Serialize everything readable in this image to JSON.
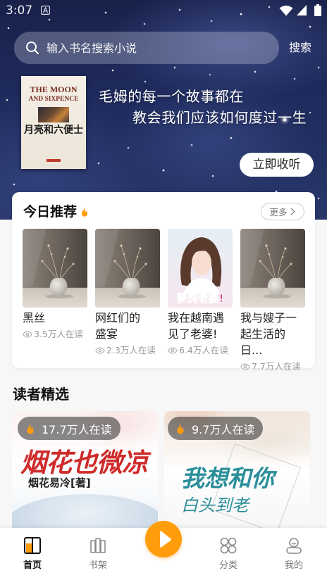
{
  "status_bar": {
    "time": "3:07"
  },
  "search": {
    "placeholder": "输入书名搜索小说",
    "button_label": "搜索"
  },
  "banner": {
    "cover": {
      "title_en_line1": "THE MOON",
      "title_en_line2": "AND SIXPENCE",
      "title_cn": "月亮和六便士"
    },
    "tagline_line1": "毛姆的每一个故事都在",
    "tagline_line2": "教会我们应该如何度过一生",
    "button_label": "立即收听"
  },
  "today": {
    "title": "今日推荐",
    "title_icon": "fire-icon",
    "more_label": "更多",
    "books": [
      {
        "title": "黑丝",
        "readers": "3.5万人在读",
        "cover": "vase-still-life"
      },
      {
        "title": "网红们的\n盛宴",
        "readers": "2.3万人在读",
        "cover": "vase-still-life"
      },
      {
        "title": "我在越南遇\n见了老婆!",
        "readers": "6.4万人在读",
        "cover": "girl-illustration",
        "cover_text": "萝莉老婆!"
      },
      {
        "title": "我与嫂子一\n起生活的日...",
        "readers": "7.7万人在读",
        "cover": "vase-still-life"
      }
    ]
  },
  "readers_pick": {
    "title": "读者精选",
    "books": [
      {
        "readers": "17.7万人在读",
        "cover_title": "烟花也微凉",
        "cover_author": "烟花易冷[著]"
      },
      {
        "readers": "9.7万人在读",
        "cover_title_line1": "我想和你",
        "cover_title_line2": "白头到老"
      }
    ]
  },
  "tabbar": {
    "items": [
      {
        "label": "首页",
        "icon": "home-book-icon",
        "active": true
      },
      {
        "label": "书架",
        "icon": "bookshelf-icon",
        "active": false
      },
      {
        "label": "分类",
        "icon": "category-icon",
        "active": false
      },
      {
        "label": "我的",
        "icon": "profile-icon",
        "active": false
      }
    ],
    "center_button_icon": "play-icon"
  },
  "colors": {
    "accent": "#FF9D0D",
    "banner_bg": "#1F2B5D",
    "active_tab": "#111111",
    "inactive_tab": "#777777",
    "reader_count": "#9A9A9A"
  }
}
